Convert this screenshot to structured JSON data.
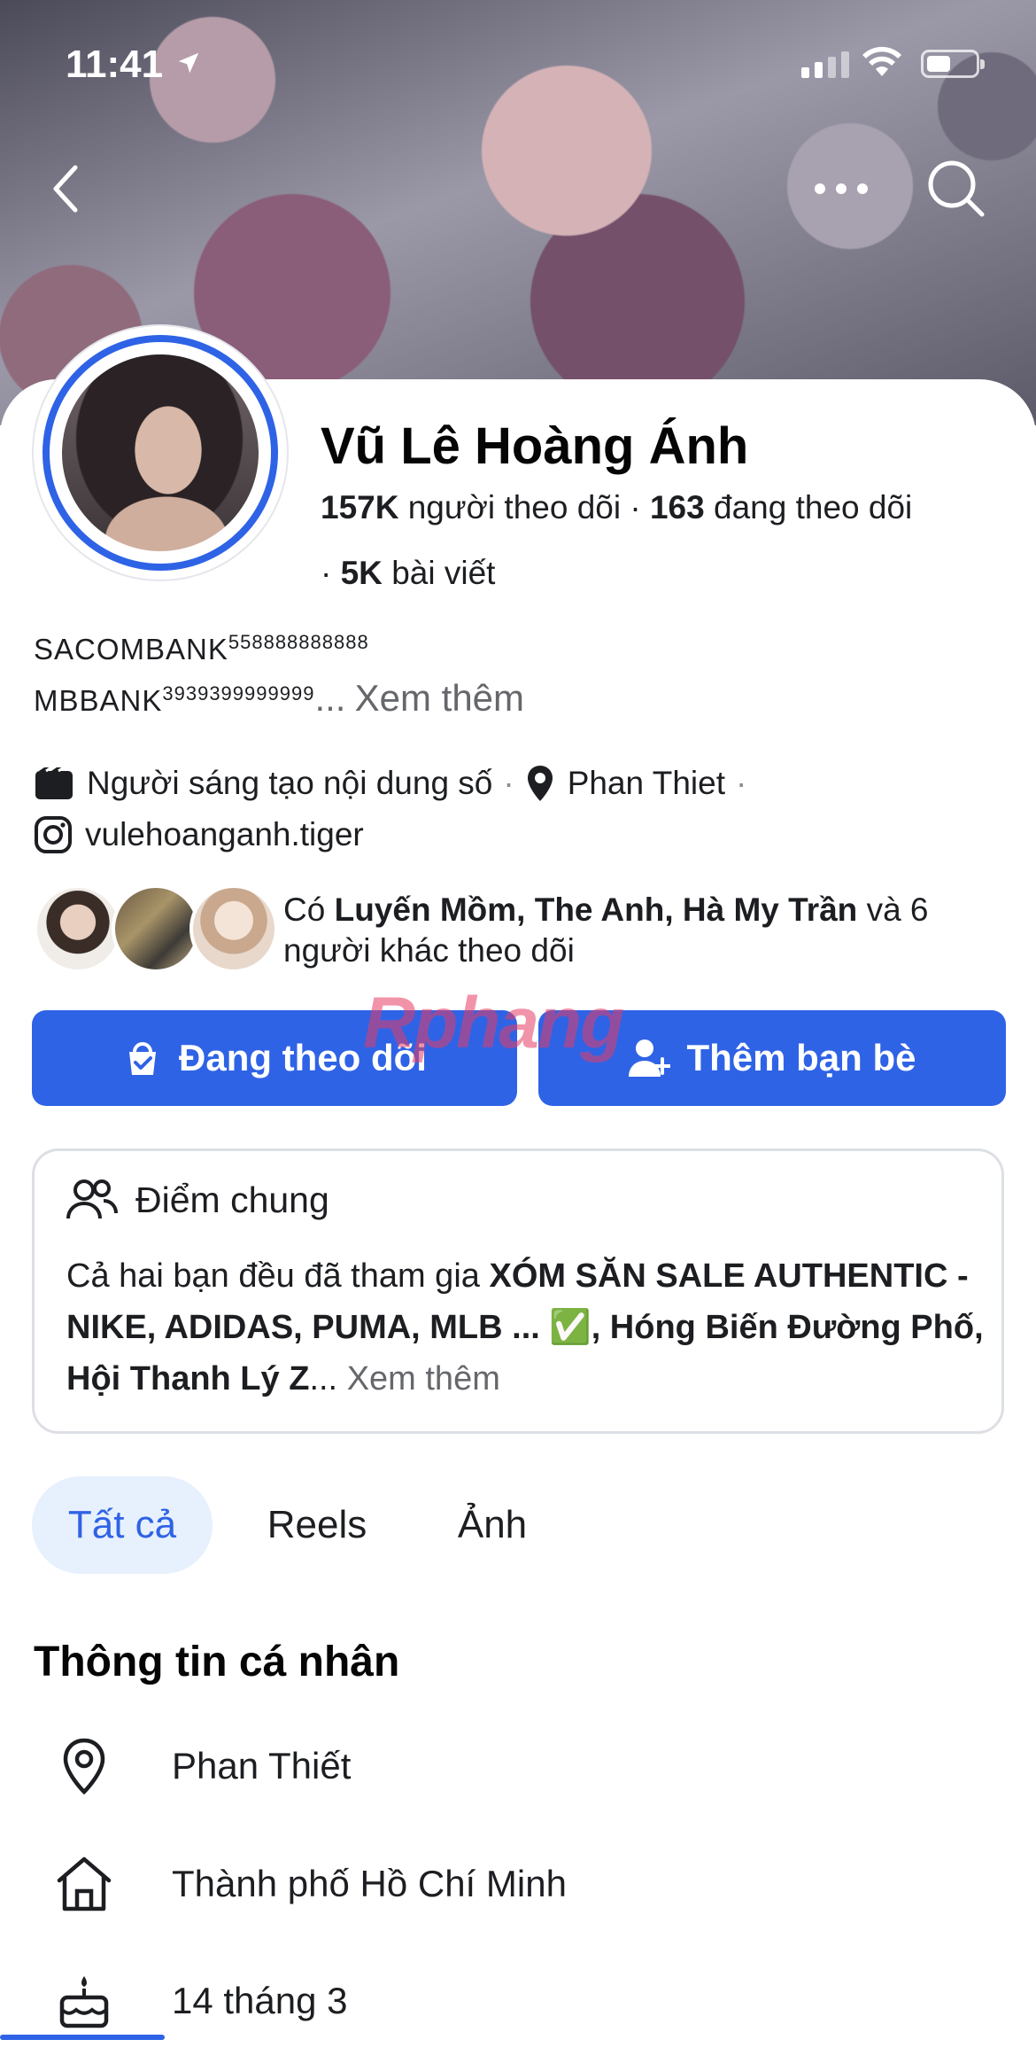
{
  "status_bar": {
    "time": "11:41"
  },
  "profile": {
    "name": "Vũ Lê Hoàng Ánh",
    "followers_count": "157K",
    "followers_label": "người theo dõi",
    "following_count": "163",
    "following_label": "đang theo dõi",
    "posts_count": "5K",
    "posts_label": "bài viết"
  },
  "bio": {
    "line1_text": "SACOMBANK",
    "line1_sup": "558888888888",
    "line2_text": "MBBANK",
    "line2_sup": "3939399999999",
    "line2_ellipsis": "...",
    "see_more": "Xem thêm"
  },
  "info": {
    "category": "Người sáng tạo nội dung số",
    "location": "Phan Thiet",
    "instagram": "vulehoanganh.tiger"
  },
  "mutual": {
    "prefix": "Có",
    "names": "Luyến Mồm, The Anh, Hà My Trần",
    "connector": "và 6",
    "suffix": "người khác theo dõi"
  },
  "actions": {
    "following_label": "Đang theo dõi",
    "add_friend_label": "Thêm bạn bè"
  },
  "watermark": "Rphang",
  "common": {
    "title": "Điểm chung",
    "prefix": "Cả hai bạn đều đã tham gia",
    "groups_bold": "XÓM SĂN SALE AUTHENTIC - NIKE, ADIDAS, PUMA, MLB ... ✅, Hóng Biến Đường Phố, Hội Thanh Lý Z",
    "ellipsis": "...",
    "see_more": "Xem thêm"
  },
  "tabs": [
    {
      "label": "Tất cả",
      "active": true
    },
    {
      "label": "Reels",
      "active": false
    },
    {
      "label": "Ảnh",
      "active": false
    }
  ],
  "personal_info": {
    "title": "Thông tin cá nhân",
    "items": [
      {
        "icon": "map-pin-icon",
        "text": "Phan Thiết"
      },
      {
        "icon": "home-icon",
        "text": "Thành phố Hồ Chí Minh"
      },
      {
        "icon": "birthday-cake-icon",
        "text": "14 tháng 3"
      }
    ]
  },
  "colors": {
    "accent": "#2f63e6",
    "active_tab_bg": "#e7f0fd",
    "muted_text": "#65676b"
  }
}
